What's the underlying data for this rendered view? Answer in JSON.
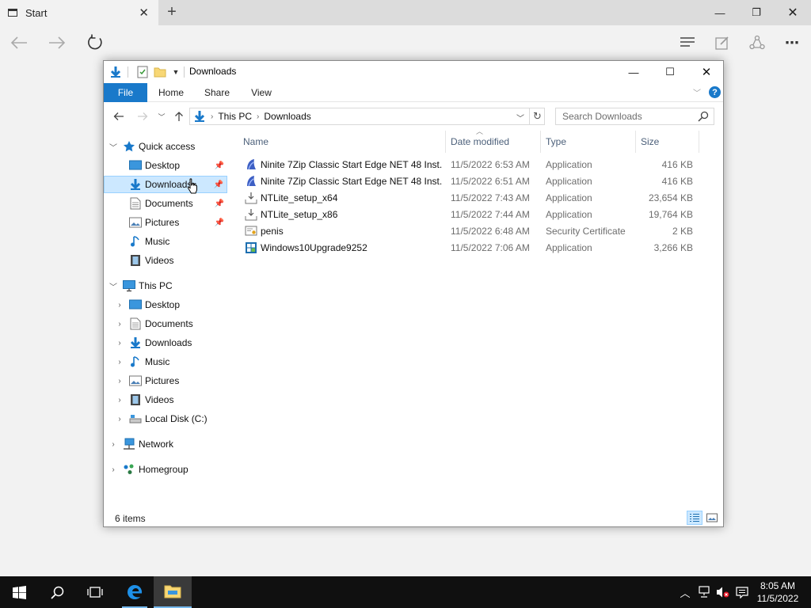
{
  "browser": {
    "tab_title": "Start",
    "icons": {
      "back": "back-arrow-icon",
      "forward": "forward-arrow-icon",
      "refresh": "refresh-icon",
      "hub": "hub-icon",
      "notes": "web-note-icon",
      "share": "share-icon",
      "more": "more-icon"
    }
  },
  "explorer": {
    "title": "Downloads",
    "ribbon_tabs": [
      "File",
      "Home",
      "Share",
      "View"
    ],
    "address": {
      "segments": [
        "This PC",
        "Downloads"
      ]
    },
    "search_placeholder": "Search Downloads",
    "accent": "#1979ca",
    "navigation": {
      "quick_access": {
        "label": "Quick access",
        "items": [
          {
            "label": "Desktop",
            "pinned": true
          },
          {
            "label": "Downloads",
            "pinned": true,
            "selected": true
          },
          {
            "label": "Documents",
            "pinned": true
          },
          {
            "label": "Pictures",
            "pinned": true
          },
          {
            "label": "Music",
            "pinned": false
          },
          {
            "label": "Videos",
            "pinned": false
          }
        ]
      },
      "this_pc": {
        "label": "This PC",
        "items": [
          "Desktop",
          "Documents",
          "Downloads",
          "Music",
          "Pictures",
          "Videos",
          "Local Disk (C:)"
        ]
      },
      "network": "Network",
      "homegroup": "Homegroup"
    },
    "columns": [
      "Name",
      "Date modified",
      "Type",
      "Size"
    ],
    "files": [
      {
        "name": "Ninite 7Zip Classic Start Edge NET 48 Inst...",
        "date": "11/5/2022 6:53 AM",
        "type": "Application",
        "size": "416 KB",
        "icon": "ninite-icon"
      },
      {
        "name": "Ninite 7Zip Classic Start Edge NET 48 Inst...",
        "date": "11/5/2022 6:51 AM",
        "type": "Application",
        "size": "416 KB",
        "icon": "ninite-icon"
      },
      {
        "name": "NTLite_setup_x64",
        "date": "11/5/2022 7:43 AM",
        "type": "Application",
        "size": "23,654 KB",
        "icon": "installer-icon"
      },
      {
        "name": "NTLite_setup_x86",
        "date": "11/5/2022 7:44 AM",
        "type": "Application",
        "size": "19,764 KB",
        "icon": "installer-icon"
      },
      {
        "name": "penis",
        "date": "11/5/2022 6:48 AM",
        "type": "Security Certificate",
        "size": "2 KB",
        "icon": "certificate-icon"
      },
      {
        "name": "Windows10Upgrade9252",
        "date": "11/5/2022 7:06 AM",
        "type": "Application",
        "size": "3,266 KB",
        "icon": "windows-upgrade-icon"
      }
    ],
    "status": "6 items"
  },
  "taskbar": {
    "time": "8:05 AM",
    "date": "11/5/2022"
  }
}
